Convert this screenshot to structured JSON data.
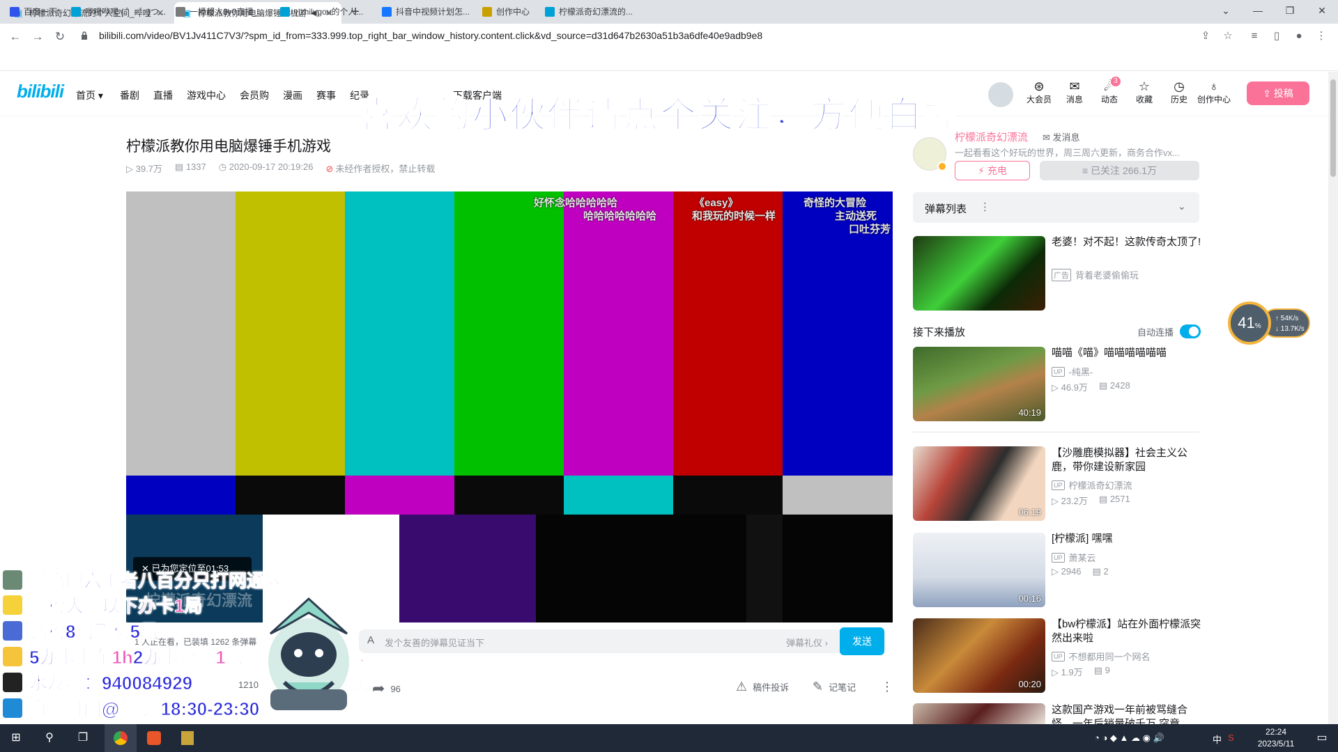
{
  "browser": {
    "tabs": [
      {
        "title": "柠檬派奇幻漂流的个人空间_哔哩",
        "active": false
      },
      {
        "title": "柠檬派教你用电脑爆锤手机游",
        "active": true
      }
    ],
    "url": "bilibili.com/video/BV1Jv411C7V3/?spm_id_from=333.999.top_right_bar_window_history.content.click&vd_source=d31d647b2630a51b3a6dfe40e9adb9e8",
    "bookmarks": [
      "百度一下",
      "哔哩哔哩 ( ゜- ゜)つ...",
      "一播超人0v0直播_...",
      "yizhilugou的个人...",
      "抖音中视频计划怎...",
      "创作中心",
      "柠檬派奇幻漂流的..."
    ]
  },
  "header": {
    "logo": "bilibili",
    "nav": [
      "首页",
      "番剧",
      "直播",
      "游戏中心",
      "会员购",
      "漫画",
      "赛事",
      "纪录",
      "下载客户端"
    ],
    "banner": "喜欢的小伙伴请点个关注，方便白嫖",
    "icons": [
      {
        "label": "大会员",
        "icon": "vip-icon"
      },
      {
        "label": "消息",
        "icon": "message-icon"
      },
      {
        "label": "动态",
        "icon": "dynamic-icon"
      },
      {
        "label": "收藏",
        "icon": "favorite-icon"
      },
      {
        "label": "历史",
        "icon": "history-icon"
      },
      {
        "label": "创作中心",
        "icon": "creator-icon"
      }
    ],
    "dynamic_badge": "3",
    "upload": "投稿"
  },
  "video": {
    "title": "柠檬派教你用电脑爆锤手机游戏",
    "views": "39.7万",
    "danmaku_count": "1337",
    "date": "2020-09-17 20:19:26",
    "copyright": "未经作者授权，禁止转载",
    "danmu": [
      "好怀念哈哈哈哈哈",
      "哈哈哈哈哈哈哈",
      "《easy》",
      "和我玩的时候一样",
      "奇怪的大冒险",
      "主动送死",
      "口吐芬芳"
    ],
    "seek_toast": "已为您定位至01:53",
    "watermark": "柠檬派奇幻漂流",
    "online": "1 人正在看，已装填 1262 条弹幕",
    "danmu_placeholder": "发个友善的弹幕见证当下",
    "danmu_etiquette": "弹幕礼仪 ›",
    "send": "发送",
    "like_count": "1210",
    "share_count": "96",
    "report": "稿件投诉",
    "notes": "记笔记"
  },
  "uploader": {
    "name": "柠檬派奇幻漂流",
    "message": "发消息",
    "desc": "一起看看这个好玩的世界，周三周六更新，商务合作vx...",
    "charge": "充电",
    "follow": "已关注 266.1万"
  },
  "danmaku_list": {
    "label": "弹幕列表"
  },
  "ad": {
    "title": "老婆！对不起！这款传奇太顶了!",
    "tag": "广告",
    "by": "背着老婆偷偷玩"
  },
  "up_next": {
    "label": "接下来播放",
    "autoplay": "自动连播"
  },
  "recommend": [
    {
      "title": "喵喵《喵》喵喵喵喵喵喵",
      "up": "-纯黑-",
      "views": "46.9万",
      "danmaku": "2428",
      "duration": "40:19"
    },
    {
      "title": "【沙雕鹿模拟器】社会主义公鹿，带你建设新家园",
      "up": "柠檬派奇幻漂流",
      "views": "23.2万",
      "danmaku": "2571",
      "duration": "06:19"
    },
    {
      "title": "[柠檬派] 嘿嘿",
      "up": "萧某云",
      "views": "2946",
      "danmaku": "2",
      "duration": "00:16"
    },
    {
      "title": "【bw柠檬派】站在外面柠檬派突然出来啦",
      "up": "不想都用同一个网名",
      "views": "1.9万",
      "danmaku": "9",
      "duration": "00:20"
    },
    {
      "title": "这款国产游戏一年前被骂缝合怪，一年后销量破千万 突竟",
      "up": "",
      "views": "",
      "danmaku": "",
      "duration": ""
    }
  ],
  "net_widget": {
    "percent": "41",
    "unit": "%",
    "up": "54K/s",
    "down": "13.7K/s"
  },
  "stream_overlay": [
    {
      "parts": [
        {
          "t": "最高网六王者八百分",
          "c": "blue"
        },
        {
          "t": "只打网通区",
          "c": "pink"
        }
      ]
    },
    {
      "parts": [
        {
          "t": "新粉大师以下",
          "c": "blue"
        },
        {
          "t": "办卡1局",
          "c": "pink"
        }
      ]
    },
    {
      "parts": [
        {
          "t": "钻粉8局",
          "c": "blue"
        },
        {
          "t": "飞机5局",
          "c": "blue"
        }
      ]
    },
    {
      "parts": [
        {
          "t": "5办卡",
          "c": "blue"
        },
        {
          "t": "上车1h",
          "c": "pink"
        },
        {
          "t": " 2办卡",
          "c": "blue"
        },
        {
          "t": "复盘1局",
          "c": "pink"
        }
      ]
    },
    {
      "parts": [
        {
          "t": "水友群：940084929",
          "c": "blue"
        }
      ]
    },
    {
      "parts": [
        {
          "t": "直播时间@每晚 18:30-23:30",
          "c": "blue"
        }
      ]
    }
  ],
  "overlay_side": [
    "求",
    "关",
    "注"
  ],
  "taskbar": {
    "time": "22:24",
    "date": "2023/5/11",
    "ime": "中"
  }
}
